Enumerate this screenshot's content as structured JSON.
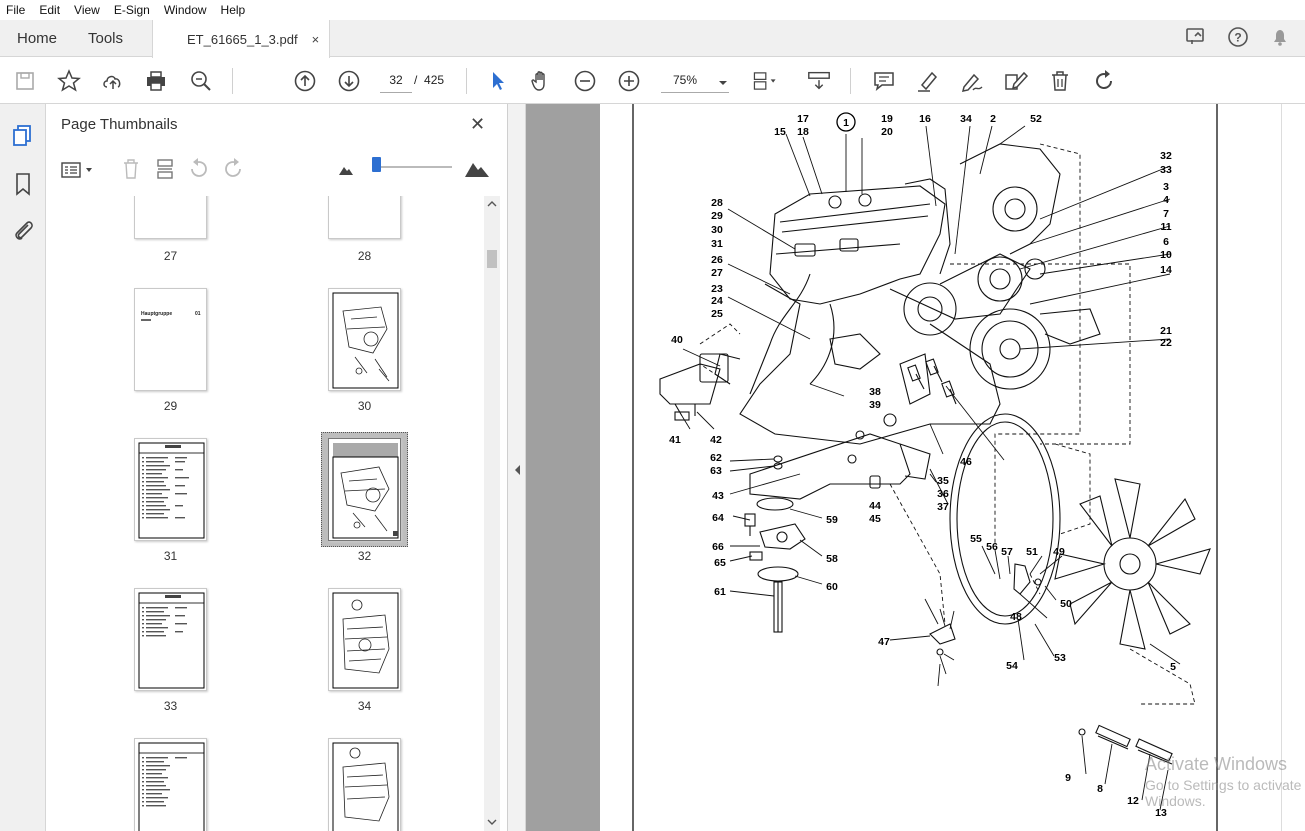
{
  "menu": [
    "File",
    "Edit",
    "View",
    "E-Sign",
    "Window",
    "Help"
  ],
  "tabs": {
    "home": "Home",
    "tools": "Tools",
    "document": "ET_61665_1_3.pdf",
    "close": "×"
  },
  "nav": {
    "current_page": "32",
    "separator": "/",
    "total_pages": "425",
    "zoom": "75%"
  },
  "panel": {
    "title": "Page Thumbnails",
    "close": "✕"
  },
  "thumbnails": [
    {
      "num": "27"
    },
    {
      "num": "28"
    },
    {
      "num": "29",
      "title": "Hauptgruppe",
      "code": "01"
    },
    {
      "num": "30"
    },
    {
      "num": "31"
    },
    {
      "num": "32"
    },
    {
      "num": "33"
    },
    {
      "num": "34"
    }
  ],
  "icons": {
    "rail": [
      "pages-icon",
      "bookmark-icon",
      "attachment-icon"
    ],
    "toolbar": [
      "save-icon",
      "star-icon",
      "upload-icon",
      "print-icon",
      "zoom-search-icon",
      "page-up-icon",
      "page-down-icon",
      "select-arrow-icon",
      "hand-icon",
      "zoom-out-icon",
      "zoom-in-icon",
      "fit-page-icon",
      "scroll-mode-icon",
      "comment-icon",
      "highlight-icon",
      "sign-icon",
      "edit-icon",
      "delete-icon",
      "rotate-icon"
    ]
  },
  "accent": "#2d6fd1",
  "diagram": {
    "labels_left": [
      "28",
      "29",
      "30",
      "31",
      "26",
      "27",
      "23",
      "24",
      "25",
      "40",
      "41",
      "42",
      "62",
      "63",
      "43",
      "64",
      "66",
      "65",
      "61"
    ],
    "labels_top": [
      "17",
      "18",
      "15",
      "1",
      "19",
      "20",
      "16",
      "34",
      "2",
      "52"
    ],
    "labels_right": [
      "32",
      "33",
      "3",
      "4",
      "7",
      "11",
      "6",
      "10",
      "14",
      "21",
      "22"
    ],
    "labels_center": [
      "38",
      "39",
      "46",
      "35",
      "36",
      "37",
      "44",
      "45",
      "59",
      "58",
      "60",
      "55",
      "56",
      "57",
      "51",
      "49",
      "50",
      "48",
      "47",
      "54",
      "53",
      "5",
      "9",
      "8",
      "12",
      "13"
    ]
  },
  "watermark": {
    "line1": "Activate Windows",
    "line2": "Go to Settings to activate Windows."
  }
}
